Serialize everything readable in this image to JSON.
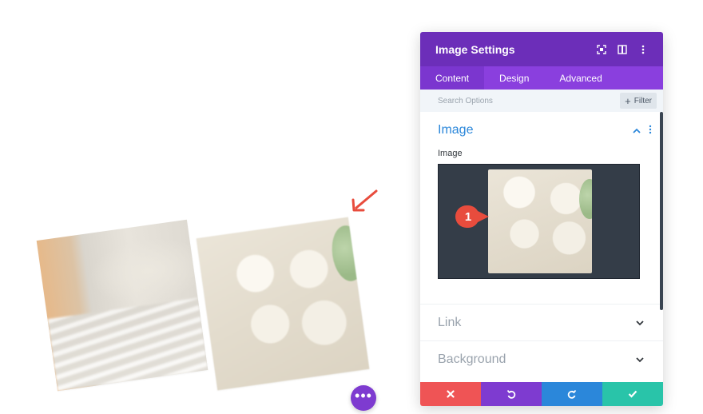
{
  "modal": {
    "title": "Image Settings",
    "tabs": [
      {
        "label": "Content"
      },
      {
        "label": "Design"
      },
      {
        "label": "Advanced"
      }
    ],
    "search": {
      "placeholder": "Search Options",
      "filter_label": "Filter"
    },
    "section": {
      "title": "Image",
      "field_label": "Image",
      "annotation_number": "1"
    },
    "collapsed_sections": [
      {
        "label": "Link"
      },
      {
        "label": "Background"
      }
    ],
    "footer": {
      "cancel_color": "#ef5455",
      "undo_color": "#7e3bd0",
      "redo_color": "#2b87da",
      "save_color": "#29c4a9"
    }
  },
  "colors": {
    "header": "#6c2eb9",
    "tabs": "#8a3fde",
    "accent_blue": "#2b87da",
    "arrow": "#e84c3d"
  },
  "icons": {
    "fullscreen": "fullscreen-icon",
    "split": "split-view-icon",
    "kebab": "kebab-icon"
  }
}
